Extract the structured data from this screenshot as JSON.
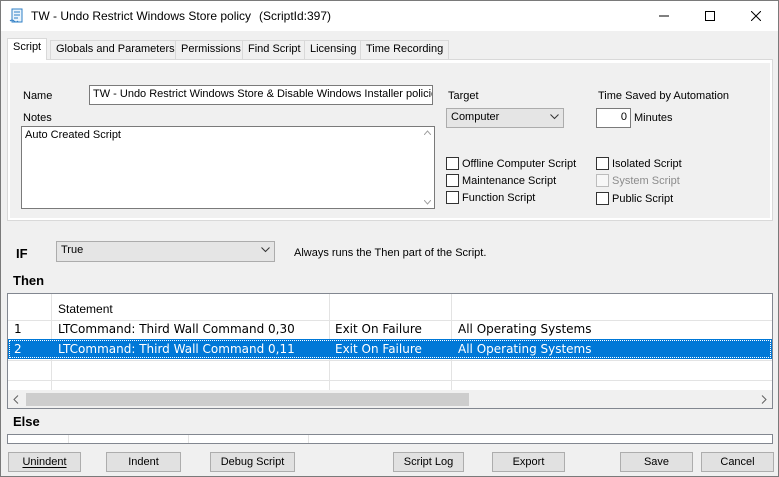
{
  "window": {
    "title": "TW - Undo Restrict Windows Store policy",
    "script_id": "(ScriptId:397)"
  },
  "tabs": [
    "Script",
    "Globals and Parameters",
    "Permissions",
    "Find Script",
    "Licensing",
    "Time Recording"
  ],
  "form": {
    "name_label": "Name",
    "name_value": "TW - Undo Restrict Windows Store & Disable Windows Installer policies",
    "notes_label": "Notes",
    "notes_value": "Auto Created Script",
    "target_label": "Target",
    "target_value": "Computer",
    "time_saved_label": "Time Saved by Automation",
    "time_saved_value": "0",
    "minutes_label": "Minutes",
    "checkboxes": {
      "offline": "Offline Computer Script",
      "maintenance": "Maintenance Script",
      "function": "Function Script",
      "isolated": "Isolated Script",
      "system": "System Script",
      "public": "Public Script"
    }
  },
  "if_section": {
    "label": "IF",
    "condition": "True",
    "description": "Always runs the Then part of the Script."
  },
  "then_section": {
    "label": "Then",
    "columns": [
      "",
      "Statement",
      "",
      ""
    ],
    "rows": [
      {
        "num": "1",
        "statement": "LTCommand: Third Wall Command 0,30",
        "on_failure": "Exit On Failure",
        "os": "All Operating Systems"
      },
      {
        "num": "2",
        "statement": "LTCommand: Third Wall Command 0,11",
        "on_failure": "Exit On Failure",
        "os": "All Operating Systems"
      }
    ]
  },
  "else_section": {
    "label": "Else"
  },
  "buttons": {
    "unindent": "Unindent",
    "indent": "Indent",
    "debug": "Debug Script",
    "script_log": "Script Log",
    "export": "Export",
    "save": "Save",
    "cancel": "Cancel"
  }
}
